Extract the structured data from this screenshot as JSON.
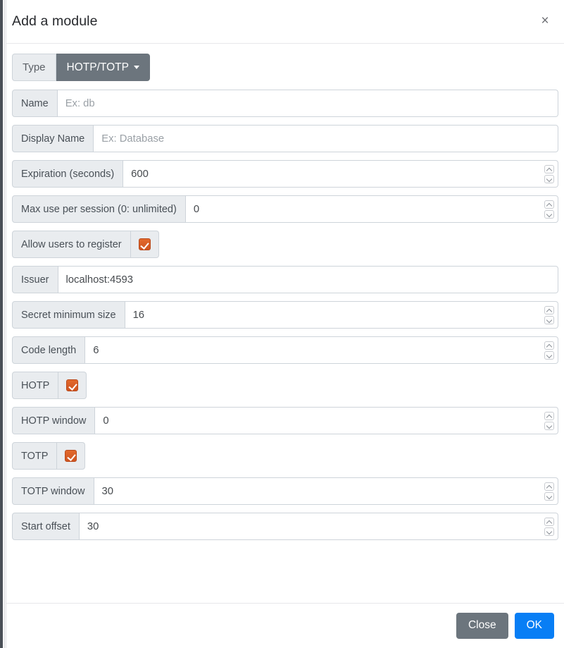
{
  "modal": {
    "title": "Add a module",
    "close_icon": "close-icon",
    "close_label": "×"
  },
  "type_row": {
    "label": "Type",
    "selected": "HOTP/TOTP",
    "caret_icon": "chevron-down-icon"
  },
  "fields": [
    {
      "key": "name",
      "label": "Name",
      "kind": "text",
      "value": "",
      "placeholder": "Ex: db"
    },
    {
      "key": "display_name",
      "label": "Display Name",
      "kind": "text",
      "value": "",
      "placeholder": "Ex: Database"
    },
    {
      "key": "expiration",
      "label": "Expiration (seconds)",
      "kind": "number",
      "value": "600",
      "placeholder": ""
    },
    {
      "key": "max_use",
      "label": "Max use per session (0: unlimited)",
      "kind": "number",
      "value": "0",
      "placeholder": ""
    },
    {
      "key": "allow_register",
      "label": "Allow users to register",
      "kind": "checkbox",
      "value": "checked",
      "placeholder": ""
    },
    {
      "key": "issuer",
      "label": "Issuer",
      "kind": "text",
      "value": "localhost:4593",
      "placeholder": ""
    },
    {
      "key": "secret_min",
      "label": "Secret minimum size",
      "kind": "number",
      "value": "16",
      "placeholder": ""
    },
    {
      "key": "code_length",
      "label": "Code length",
      "kind": "number",
      "value": "6",
      "placeholder": ""
    },
    {
      "key": "hotp",
      "label": "HOTP",
      "kind": "checkbox",
      "value": "checked",
      "placeholder": ""
    },
    {
      "key": "hotp_window",
      "label": "HOTP window",
      "kind": "number",
      "value": "0",
      "placeholder": ""
    },
    {
      "key": "totp",
      "label": "TOTP",
      "kind": "checkbox",
      "value": "checked",
      "placeholder": ""
    },
    {
      "key": "totp_window",
      "label": "TOTP window",
      "kind": "number",
      "value": "30",
      "placeholder": ""
    },
    {
      "key": "start_offset",
      "label": "Start offset",
      "kind": "number",
      "value": "30",
      "placeholder": ""
    }
  ],
  "footer": {
    "close_label": "Close",
    "ok_label": "OK"
  },
  "colors": {
    "accent_primary": "#087ef5",
    "secondary": "#6c757d",
    "checkbox": "#d4571f",
    "addon_bg": "#e9ecef",
    "border": "#ced4da"
  }
}
